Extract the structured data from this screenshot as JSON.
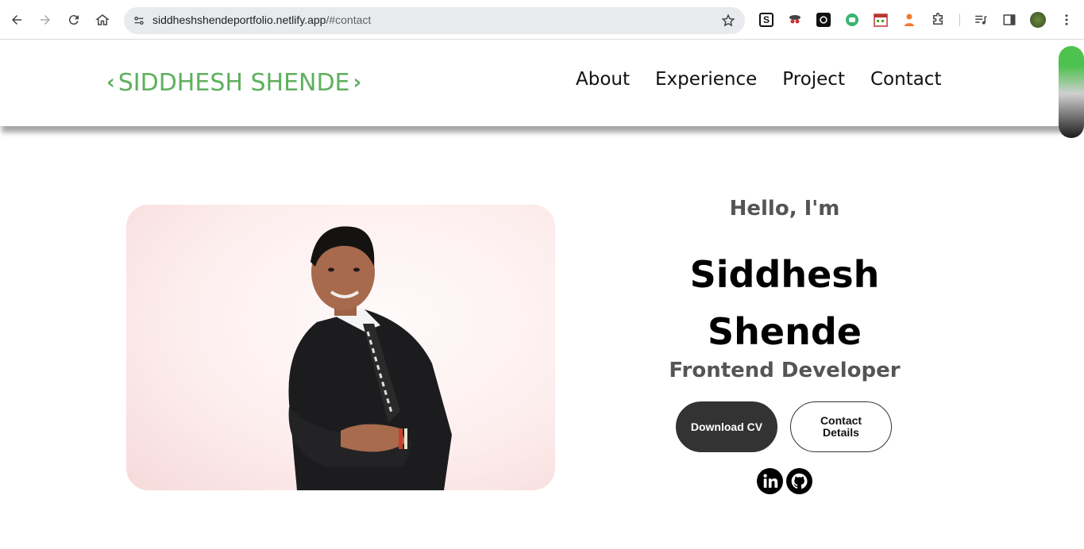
{
  "browser": {
    "url_host": "siddheshshendeportfolio.netlify.app",
    "url_path": "/#contact",
    "extensions": [
      "S"
    ]
  },
  "site": {
    "logo": {
      "left_chevron": "‹",
      "text": "SIDDHESH SHENDE",
      "right_chevron": "›"
    },
    "nav": [
      "About",
      "Experience",
      "Project",
      "Contact"
    ]
  },
  "hero": {
    "greeting": "Hello, I'm",
    "name": "Siddhesh Shende",
    "role": "Frontend Developer",
    "download_cv": "Download CV",
    "contact_details": "Contact Details",
    "social": [
      "linkedin-icon",
      "github-icon"
    ]
  },
  "colors": {
    "accent": "#5fb05f",
    "dark_button": "#333333",
    "heading": "#000000",
    "subheading": "#555555"
  }
}
